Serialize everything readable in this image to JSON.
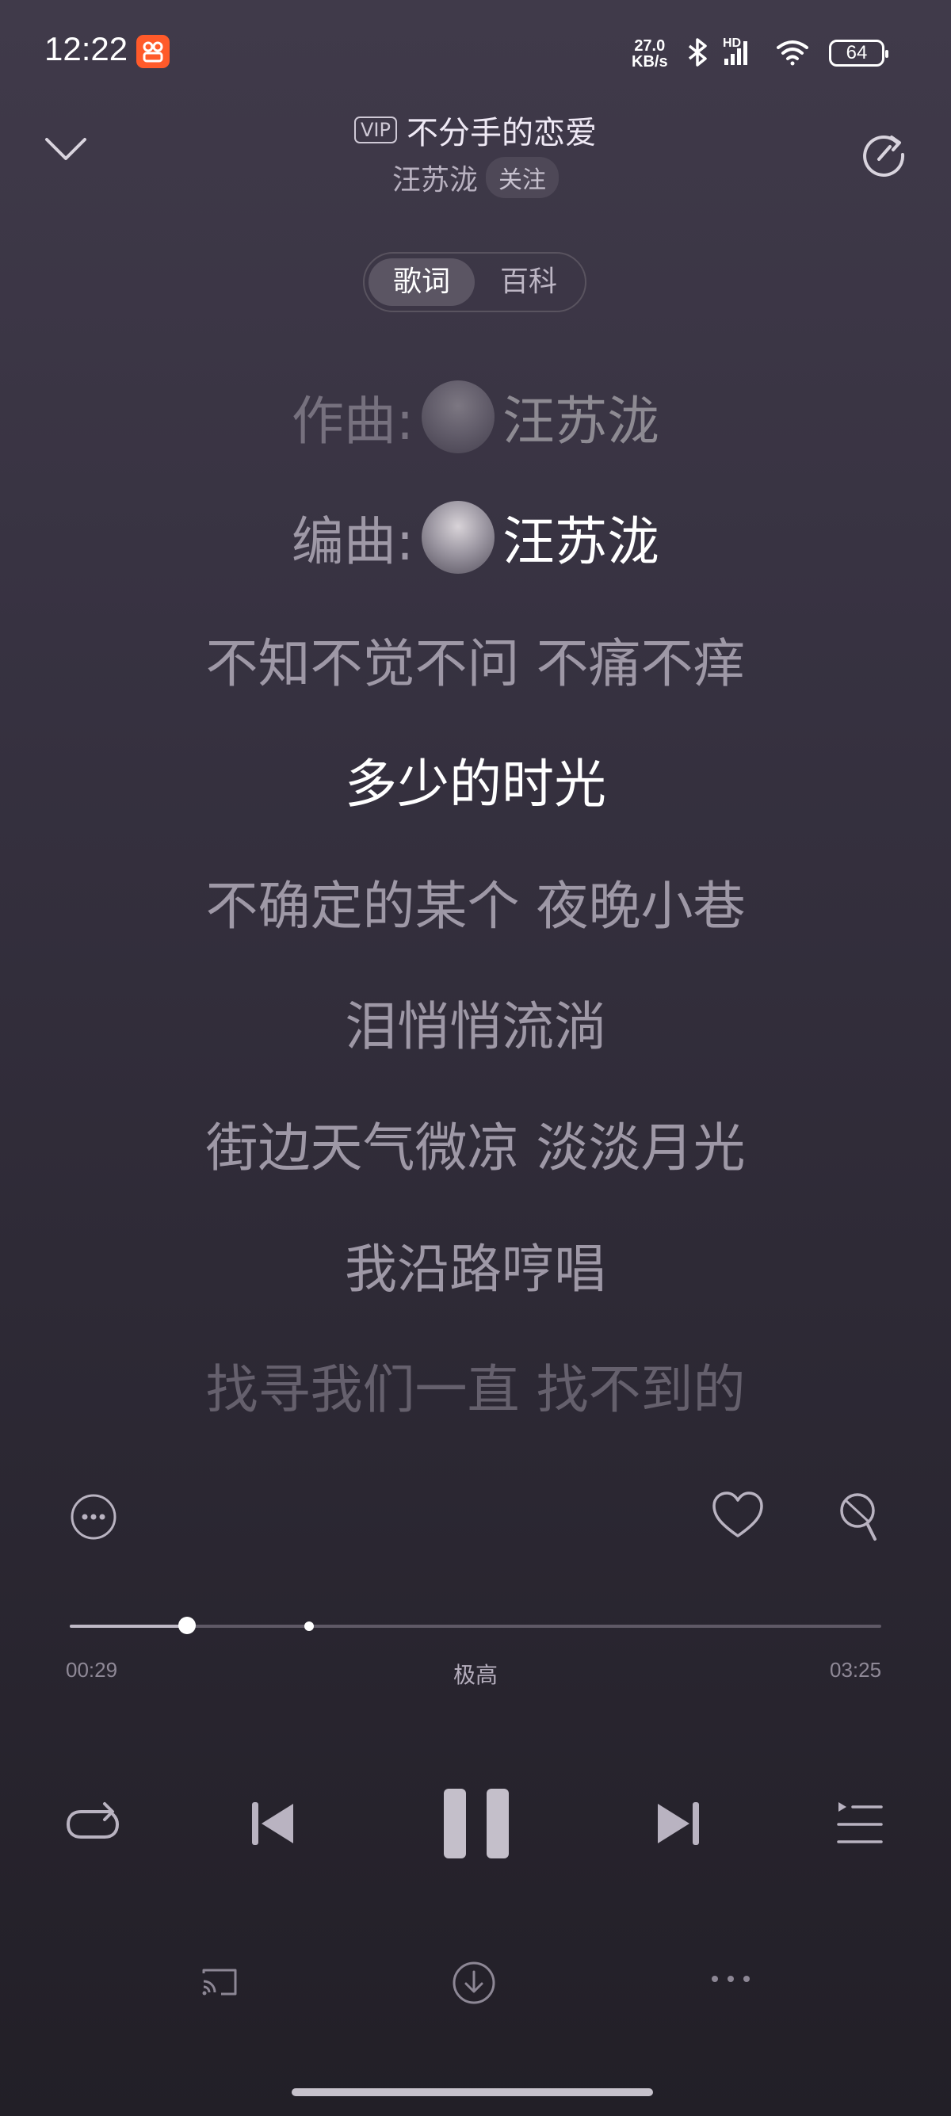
{
  "status_bar": {
    "time": "12:22",
    "net_speed_value": "27.0",
    "net_speed_unit": "KB/s",
    "network_label": "HD",
    "battery": "64",
    "icons": [
      "app-badge-icon",
      "bluetooth-icon",
      "signal-icon",
      "wifi-icon",
      "battery-icon"
    ]
  },
  "header": {
    "vip_badge": "VIP",
    "song_title": "不分手的恋爱",
    "artist": "汪苏泷",
    "follow_label": "关注"
  },
  "tabs": [
    {
      "label": "歌词",
      "selected": true
    },
    {
      "label": "百科",
      "selected": false
    }
  ],
  "credits": [
    {
      "role": "作曲:",
      "name": "汪苏泷"
    },
    {
      "role": "编曲:",
      "name": "汪苏泷"
    }
  ],
  "lyrics": [
    "不知不觉不问 不痛不痒",
    "多少的时光",
    "不确定的某个 夜晚小巷",
    "泪悄悄流淌",
    "街边天气微凉 淡淡月光",
    "我沿路哼唱",
    "找寻我们一直 找不到的"
  ],
  "current_lyric_index": 1,
  "player": {
    "current_time": "00:29",
    "total_time": "03:25",
    "quality": "极高",
    "progress": 0.142
  },
  "colors": {
    "background_top": "#403a4a",
    "background_bottom": "#221f27",
    "active_lyric": "#ffffff",
    "inactive_lyric": "#9e98a6"
  }
}
